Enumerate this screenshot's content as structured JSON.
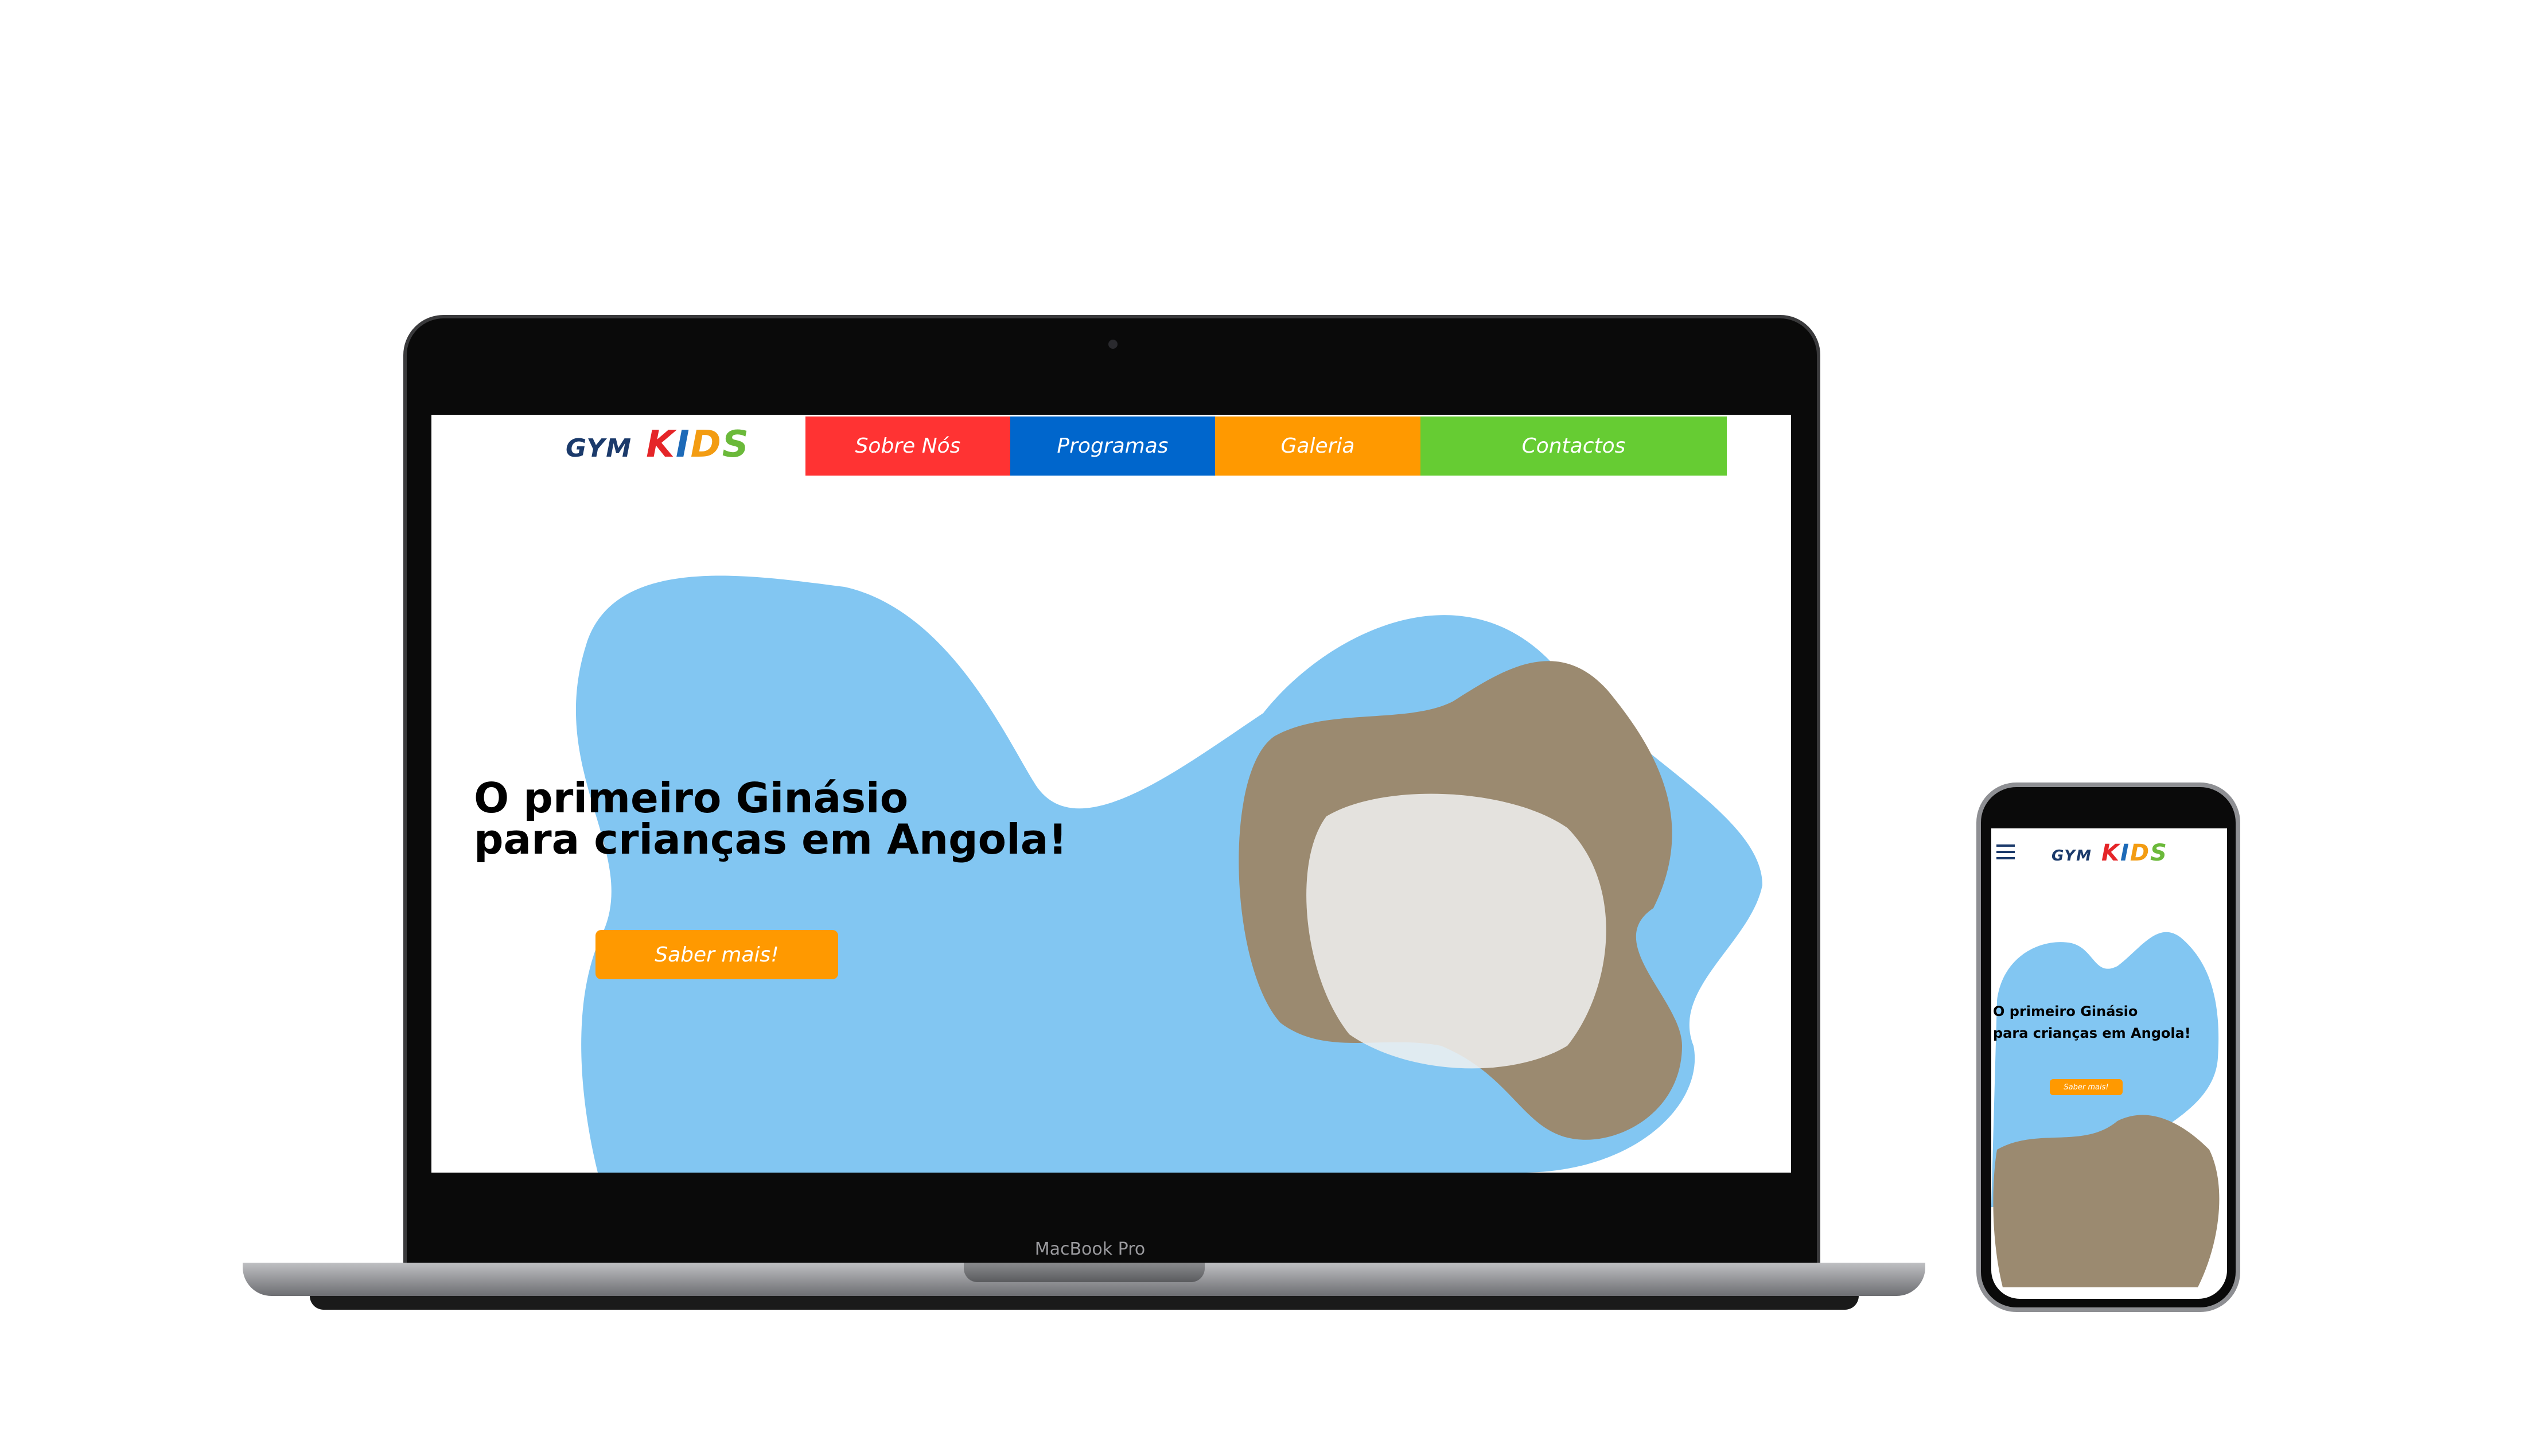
{
  "site": {
    "logo": {
      "gym": "GYM",
      "kids": [
        "K",
        "I",
        "D",
        "S"
      ]
    },
    "nav": [
      {
        "label": "Sobre Nós",
        "color": "#ff3333"
      },
      {
        "label": "Programas",
        "color": "#0066cc"
      },
      {
        "label": "Galeria",
        "color": "#ff9900"
      },
      {
        "label": "Contactos",
        "color": "#66cc33"
      }
    ],
    "hero": {
      "line1": "O primeiro Ginásio",
      "line2": "para crianças em Angola!",
      "cta": "Saber mais!"
    },
    "blob_color": "#82c6f2"
  },
  "device": {
    "laptop_label": "MacBook Pro"
  },
  "icons": {
    "menu": "hamburger-menu-icon"
  }
}
